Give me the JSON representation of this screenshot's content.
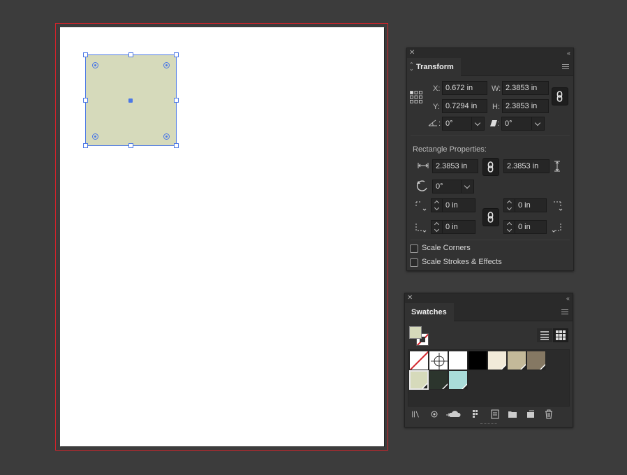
{
  "transform": {
    "tab_label": "Transform",
    "x_label": "X:",
    "x_value": "0.672 in",
    "y_label": "Y:",
    "y_value": "0.7294 in",
    "w_label": "W:",
    "w_value": "2.3853 in",
    "h_label": "H:",
    "h_value": "2.3853 in",
    "rotate_value": "0°",
    "shear_value": "0°",
    "rect_props_label": "Rectangle Properties:",
    "rect_width": "2.3853 in",
    "rect_height": "2.3853 in",
    "rect_rotation": "0°",
    "corner_tl": "0 in",
    "corner_tr": "0 in",
    "corner_bl": "0 in",
    "corner_br": "0 in",
    "scale_corners_label": "Scale Corners",
    "scale_strokes_label": "Scale Strokes & Effects"
  },
  "swatches": {
    "tab_label": "Swatches",
    "fill_color": "#d6dabb",
    "colors_row1": [
      "none",
      "registration",
      "#ffffff",
      "#000000",
      "#f1ead9",
      "#c3b999",
      "#857863"
    ],
    "colors_row2": [
      "#d6dabb",
      "#2c352d",
      "#a9dcd9"
    ]
  },
  "panel_controls": {
    "close_glyph": "✕",
    "collapse_glyph": "‹‹"
  }
}
